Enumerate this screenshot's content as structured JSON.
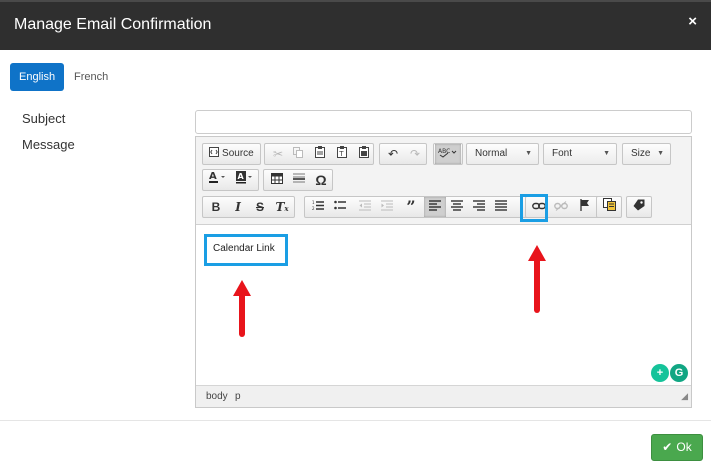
{
  "dialog": {
    "title": "Manage Email Confirmation",
    "close_glyph": "×"
  },
  "tabs": [
    {
      "label": "English",
      "active": true
    },
    {
      "label": "French",
      "active": false
    }
  ],
  "form": {
    "subject_label": "Subject",
    "message_label": "Message",
    "subject_value": ""
  },
  "toolbar": {
    "source_label": "Source",
    "format_combo": "Normal",
    "font_combo": "Font",
    "size_combo": "Size"
  },
  "editor": {
    "content_text": "Calendar Link"
  },
  "statusbar": {
    "path": [
      "body",
      "p"
    ]
  },
  "footer": {
    "ok_label": "Ok"
  },
  "colors": {
    "header_bg": "#2f2f2f",
    "tab_active": "#0f73c8",
    "highlight": "#1a9ee4",
    "arrow": "#e8141b",
    "ok_bg": "#4aa84e"
  }
}
